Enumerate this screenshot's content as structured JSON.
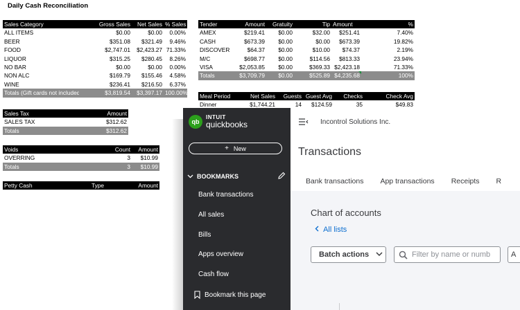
{
  "title": "Daily Cash Reconciliation",
  "sales_category": {
    "headers": [
      "Sales Category",
      "Gross Sales",
      "Net Sales",
      "% Sales"
    ],
    "rows": [
      [
        "ALL ITEMS",
        "$0.00",
        "$0.00",
        "0.00%"
      ],
      [
        "BEER",
        "$351.08",
        "$321.49",
        "9.46%"
      ],
      [
        "FOOD",
        "$2,747.01",
        "$2,423.27",
        "71.33%"
      ],
      [
        "LIQUOR",
        "$315.25",
        "$280.45",
        "8.26%"
      ],
      [
        "NO BAR",
        "$0.00",
        "$0.00",
        "0.00%"
      ],
      [
        "NON ALC",
        "$169.79",
        "$155.46",
        "4.58%"
      ],
      [
        "WINE",
        "$236.41",
        "$216.50",
        "6.37%"
      ]
    ],
    "totals": [
      "Totals (Gift cards not included)",
      "$3,819.54",
      "$3,397.17",
      "100.00%"
    ]
  },
  "tender": {
    "headers": [
      "Tender",
      "Amount",
      "Gratuity",
      "Tip",
      "Amount",
      "%"
    ],
    "rows": [
      [
        "AMEX",
        "$219.41",
        "$0.00",
        "$32.00",
        "$251.41",
        "7.40%"
      ],
      [
        "CASH",
        "$673.39",
        "$0.00",
        "$0.00",
        "$673.39",
        "19.82%"
      ],
      [
        "DISCOVER",
        "$64.37",
        "$0.00",
        "$10.00",
        "$74.37",
        "2.19%"
      ],
      [
        "M/C",
        "$698.77",
        "$0.00",
        "$114.56",
        "$813.33",
        "23.94%"
      ],
      [
        "VISA",
        "$2,053.85",
        "$0.00",
        "$369.33",
        "$2,423.18",
        "71.33%"
      ]
    ],
    "totals": [
      "Totals",
      "$3,709.79",
      "$0.00",
      "$525.89",
      "$4,235.68",
      "100%"
    ]
  },
  "meal_period": {
    "headers": [
      "Meal Period",
      "Net Sales",
      "Guests",
      "Guest Avg",
      "Checks",
      "Check Avg"
    ],
    "rows": [
      [
        "Dinner",
        "$1,744.21",
        "14",
        "$124.59",
        "35",
        "$49.83"
      ]
    ]
  },
  "sales_tax": {
    "headers": [
      "Sales Tax",
      "Amount"
    ],
    "rows": [
      [
        "SALES TAX",
        "$312.62"
      ]
    ],
    "totals": [
      "Totals",
      "$312.62"
    ]
  },
  "voids": {
    "headers": [
      "Voids",
      "Count",
      "Amount"
    ],
    "rows": [
      [
        "OVERRING",
        "3",
        "$10.99"
      ]
    ],
    "totals": [
      "Totals",
      "3",
      "$10.99"
    ]
  },
  "petty_cash": {
    "headers": [
      "Petty Cash",
      "Type",
      "Amount"
    ]
  },
  "qb": {
    "logo_top": "INTUIT",
    "logo_bottom": "quickbooks",
    "logo_mark": "qb",
    "new_label": "New",
    "bookmarks_label": "BOOKMARKS",
    "nav": [
      "Bank transactions",
      "All sales",
      "Bills",
      "Apps overview",
      "Cash flow"
    ],
    "bookmark_page": "Bookmark this page",
    "company": "Incontrol Solutions Inc.",
    "page_title": "Transactions",
    "tabs": [
      "Bank transactions",
      "App transactions",
      "Receipts",
      "R"
    ],
    "section_title": "Chart of accounts",
    "all_lists": "All lists",
    "batch_actions": "Batch actions",
    "filter_placeholder": "Filter by name or numb",
    "extra_box": "A",
    "brand_color": "#2ca01c",
    "sidebar_color": "#2a2b2e",
    "link_color": "#0d6fd0"
  }
}
